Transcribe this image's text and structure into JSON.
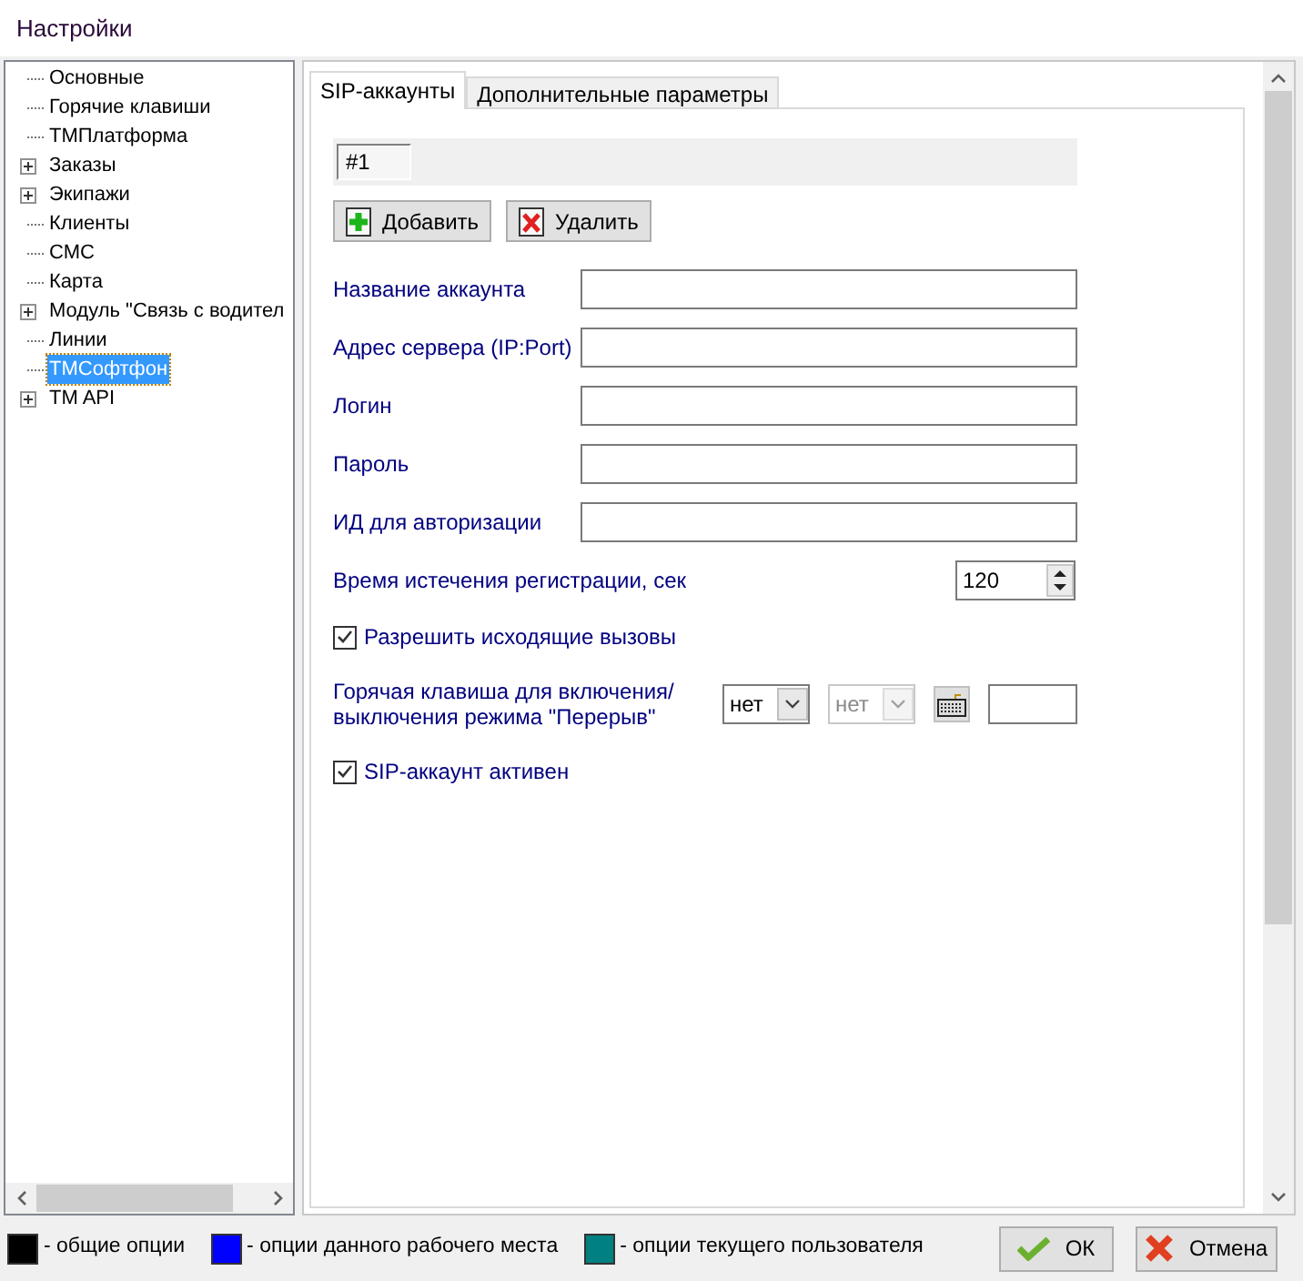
{
  "window": {
    "title": "Настройки"
  },
  "tree": [
    {
      "label": "Основные",
      "selected": false
    },
    {
      "label": "Горячие клавиши",
      "selected": false
    },
    {
      "label": "ТМПлатформа",
      "selected": false
    },
    {
      "label": "Заказы",
      "selected": false,
      "expanded": false
    },
    {
      "label": "Экипажи",
      "selected": false,
      "expanded": false
    },
    {
      "label": "Клиенты",
      "selected": false
    },
    {
      "label": "СМС",
      "selected": false
    },
    {
      "label": "Карта",
      "selected": false
    },
    {
      "label": "Модуль \"Связь с водител",
      "selected": false,
      "expanded": false
    },
    {
      "label": "Линии",
      "selected": false
    },
    {
      "label": "ТМСофтфон",
      "selected": true
    },
    {
      "label": "TM API",
      "selected": false,
      "expanded": false
    }
  ],
  "tabs": [
    {
      "label": "SIP-аккаунты",
      "selected": true
    },
    {
      "label": "Дополнительные параметры",
      "selected": false
    }
  ],
  "account_tabs": [
    {
      "label": "#1",
      "selected": true
    }
  ],
  "buttons": [
    {
      "label": "Добавить",
      "kind": "add"
    },
    {
      "label": "Удалить",
      "kind": "delete"
    }
  ],
  "fields": [
    {
      "kind": "text",
      "label": "Название аккаунта"
    },
    {
      "kind": "text",
      "label": "Адрес сервера (IP:Port)"
    },
    {
      "kind": "text",
      "label": "Логин"
    },
    {
      "kind": "text",
      "label": "Пароль"
    },
    {
      "kind": "text",
      "label": "ИД для авторизации"
    },
    {
      "kind": "spinner",
      "label": "Время истечения регистрации, сек",
      "value": "120"
    },
    {
      "kind": "checkbox",
      "label": "Разрешить исходящие вызовы",
      "checked": true
    },
    {
      "kind": "hotkey",
      "label": "Горячая клавиша для  включения/ выключения режима \"Перерыв\"",
      "modifier": "нет",
      "key": "нет",
      "key_disabled": true
    },
    {
      "kind": "checkbox",
      "label": "SIP-аккаунт активен",
      "checked": true
    }
  ],
  "legend": [
    {
      "color": "#000000",
      "label": "- общие опции"
    },
    {
      "color": "#0000ff",
      "label": "- опции данного рабочего места"
    },
    {
      "color": "#008080",
      "label": "- опции текущего пользователя"
    }
  ],
  "dialog_buttons": [
    {
      "label": "ОК",
      "kind": "ok"
    },
    {
      "label": "Отмена",
      "kind": "cancel"
    }
  ]
}
